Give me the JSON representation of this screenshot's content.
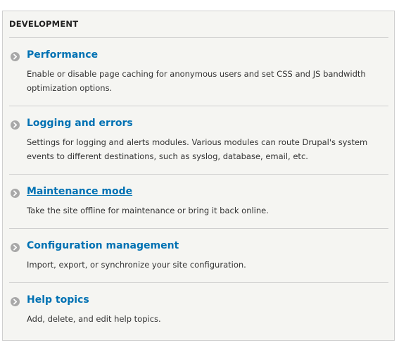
{
  "section": {
    "title": "DEVELOPMENT"
  },
  "items": [
    {
      "label": "Performance",
      "description": "Enable or disable page caching for anonymous users and set CSS and JS bandwidth optimization options."
    },
    {
      "label": "Logging and errors",
      "description": "Settings for logging and alerts modules. Various modules can route Drupal's system events to different destinations, such as syslog, database, email, etc."
    },
    {
      "label": "Maintenance mode",
      "description": "Take the site offline for maintenance or bring it back online."
    },
    {
      "label": "Configuration management",
      "description": "Import, export, or synchronize your site configuration."
    },
    {
      "label": "Help topics",
      "description": "Add, delete, and edit help topics."
    }
  ],
  "icons": {
    "item_icon": "chevron-right-circle-icon"
  },
  "colors": {
    "link": "#0071b3",
    "panel_background": "#f5f5f2",
    "border": "#cfcfcf",
    "icon": "#a8a8a8"
  }
}
